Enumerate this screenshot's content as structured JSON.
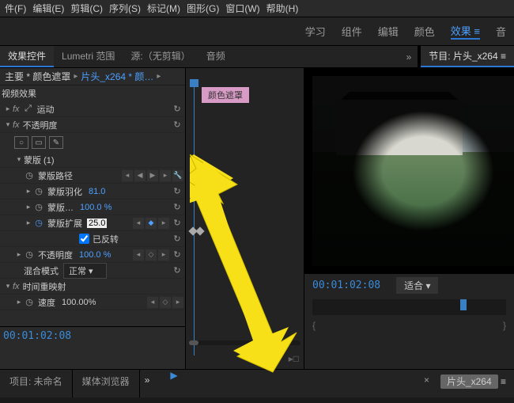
{
  "menubar": [
    "件(F)",
    "编辑(E)",
    "剪辑(C)",
    "序列(S)",
    "标记(M)",
    "图形(G)",
    "窗口(W)",
    "帮助(H)"
  ],
  "workspace": {
    "tabs": [
      "学习",
      "组件",
      "编辑",
      "颜色",
      "效果",
      "音"
    ],
    "activeIndex": 4
  },
  "panelTabs": {
    "left": [
      {
        "label": "效果控件",
        "active": true
      },
      {
        "label": "Lumetri 范围"
      }
    ],
    "source": "源:（无剪辑）",
    "audio": "音频",
    "program_label": "节目: 片头_x264"
  },
  "breadcrumb": {
    "l1": "主要 * 颜色遮罩",
    "l2": "片头_x264 * 颜…"
  },
  "clipLabel": "颜色遮罩",
  "videoEffectsHeader": "视频效果",
  "rows": {
    "motion": "运动",
    "opacity_fx": "不透明度",
    "mask": "蒙版 (1)",
    "maskPath": "蒙版路径",
    "feather": {
      "label": "蒙版羽化",
      "value": "81.0"
    },
    "maskOpacity": {
      "label": "蒙版…",
      "value": "100.0 %"
    },
    "expansion": {
      "label": "蒙版扩展",
      "value": "25.0"
    },
    "invert": "已反转",
    "opacity2": {
      "label": "不透明度",
      "value": "100.0 %"
    },
    "blend": {
      "label": "混合模式",
      "value": "正常"
    },
    "timeRemap": "时间重映射",
    "speed": {
      "label": "速度",
      "value": "100.00%"
    }
  },
  "timecode": "00:01:02:08",
  "program": {
    "timecode": "00:01:02:08",
    "fit": "适合"
  },
  "bottom": {
    "project": "项目: 未命名",
    "media": "媒体浏览器",
    "clip": "片头_x264"
  }
}
